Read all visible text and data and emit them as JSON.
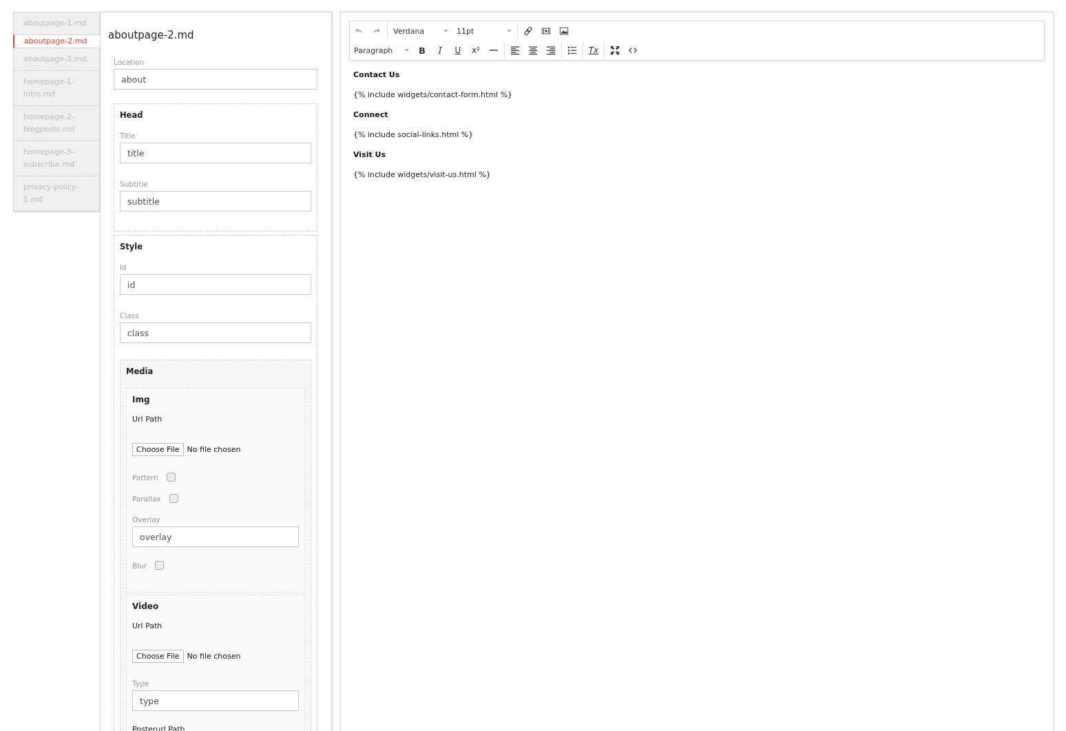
{
  "files": [
    {
      "name": "aboutpage-1.md",
      "selected": false
    },
    {
      "name": "aboutpage-2.md",
      "selected": true
    },
    {
      "name": "aboutpage-3.md",
      "selected": false
    },
    {
      "name": "homepage-1-intro.md",
      "selected": false
    },
    {
      "name": "homepage-2-blogposts.md",
      "selected": false
    },
    {
      "name": "homepage-3-subscribe.md",
      "selected": false
    },
    {
      "name": "privacy-policy-1.md",
      "selected": false
    }
  ],
  "form": {
    "title": "aboutpage-2.md",
    "location": {
      "label": "Location",
      "value": "about"
    },
    "sections": [
      {
        "heading": "Head",
        "fields": [
          {
            "label": "Title",
            "value": "title"
          },
          {
            "label": "Subtitle",
            "value": "subtitle"
          }
        ]
      },
      {
        "heading": "Style",
        "fields": [
          {
            "label": "Id",
            "value": "id"
          },
          {
            "label": "Class",
            "value": "class"
          }
        ],
        "media": {
          "heading": "Media",
          "groups": [
            {
              "heading": "Img",
              "items": [
                {
                  "kind": "file",
                  "label": "Url Path",
                  "button": "Choose File",
                  "status": "No file chosen"
                },
                {
                  "kind": "checkbox",
                  "label": "Pattern",
                  "checked": false
                },
                {
                  "kind": "checkbox",
                  "label": "Parallax",
                  "checked": false
                },
                {
                  "kind": "text",
                  "label": "Overlay",
                  "value": "overlay"
                },
                {
                  "kind": "checkbox",
                  "label": "Blur",
                  "checked": false
                }
              ]
            },
            {
              "heading": "Video",
              "items": [
                {
                  "kind": "file",
                  "label": "Url Path",
                  "button": "Choose File",
                  "status": "No file chosen"
                },
                {
                  "kind": "text",
                  "label": "Type",
                  "value": "type"
                },
                {
                  "kind": "label",
                  "label": "Posterurl Path"
                }
              ]
            }
          ]
        }
      }
    ]
  },
  "editor": {
    "toolbar": {
      "items": [
        {
          "kind": "undo"
        },
        {
          "kind": "redo"
        },
        {
          "kind": "sep"
        },
        {
          "kind": "select",
          "text": "Verdana"
        },
        {
          "kind": "select",
          "text": "11pt"
        },
        {
          "kind": "sep"
        },
        {
          "kind": "link"
        },
        {
          "kind": "media"
        },
        {
          "kind": "image"
        },
        {
          "kind": "break"
        },
        {
          "kind": "select",
          "text": "Paragraph"
        },
        {
          "kind": "bold",
          "text": "B"
        },
        {
          "kind": "italic",
          "text": "I"
        },
        {
          "kind": "underline",
          "text": "U"
        },
        {
          "kind": "superscript",
          "text": "x²"
        },
        {
          "kind": "hr"
        },
        {
          "kind": "sep"
        },
        {
          "kind": "align-left"
        },
        {
          "kind": "align-center"
        },
        {
          "kind": "align-right"
        },
        {
          "kind": "sep"
        },
        {
          "kind": "bullets"
        },
        {
          "kind": "sep"
        },
        {
          "kind": "clear-format",
          "text": "Tx"
        },
        {
          "kind": "sep"
        },
        {
          "kind": "fullscreen"
        },
        {
          "kind": "code"
        }
      ]
    },
    "content": [
      {
        "kind": "heading",
        "text": "Contact Us"
      },
      {
        "kind": "paragraph",
        "text": "{% include widgets/contact-form.html %}"
      },
      {
        "kind": "heading",
        "text": "Connect"
      },
      {
        "kind": "paragraph",
        "text": "{% include social-links.html %}"
      },
      {
        "kind": "heading",
        "text": "Visit Us"
      },
      {
        "kind": "paragraph",
        "text": "{% include widgets/visit-us.html %}"
      }
    ]
  }
}
